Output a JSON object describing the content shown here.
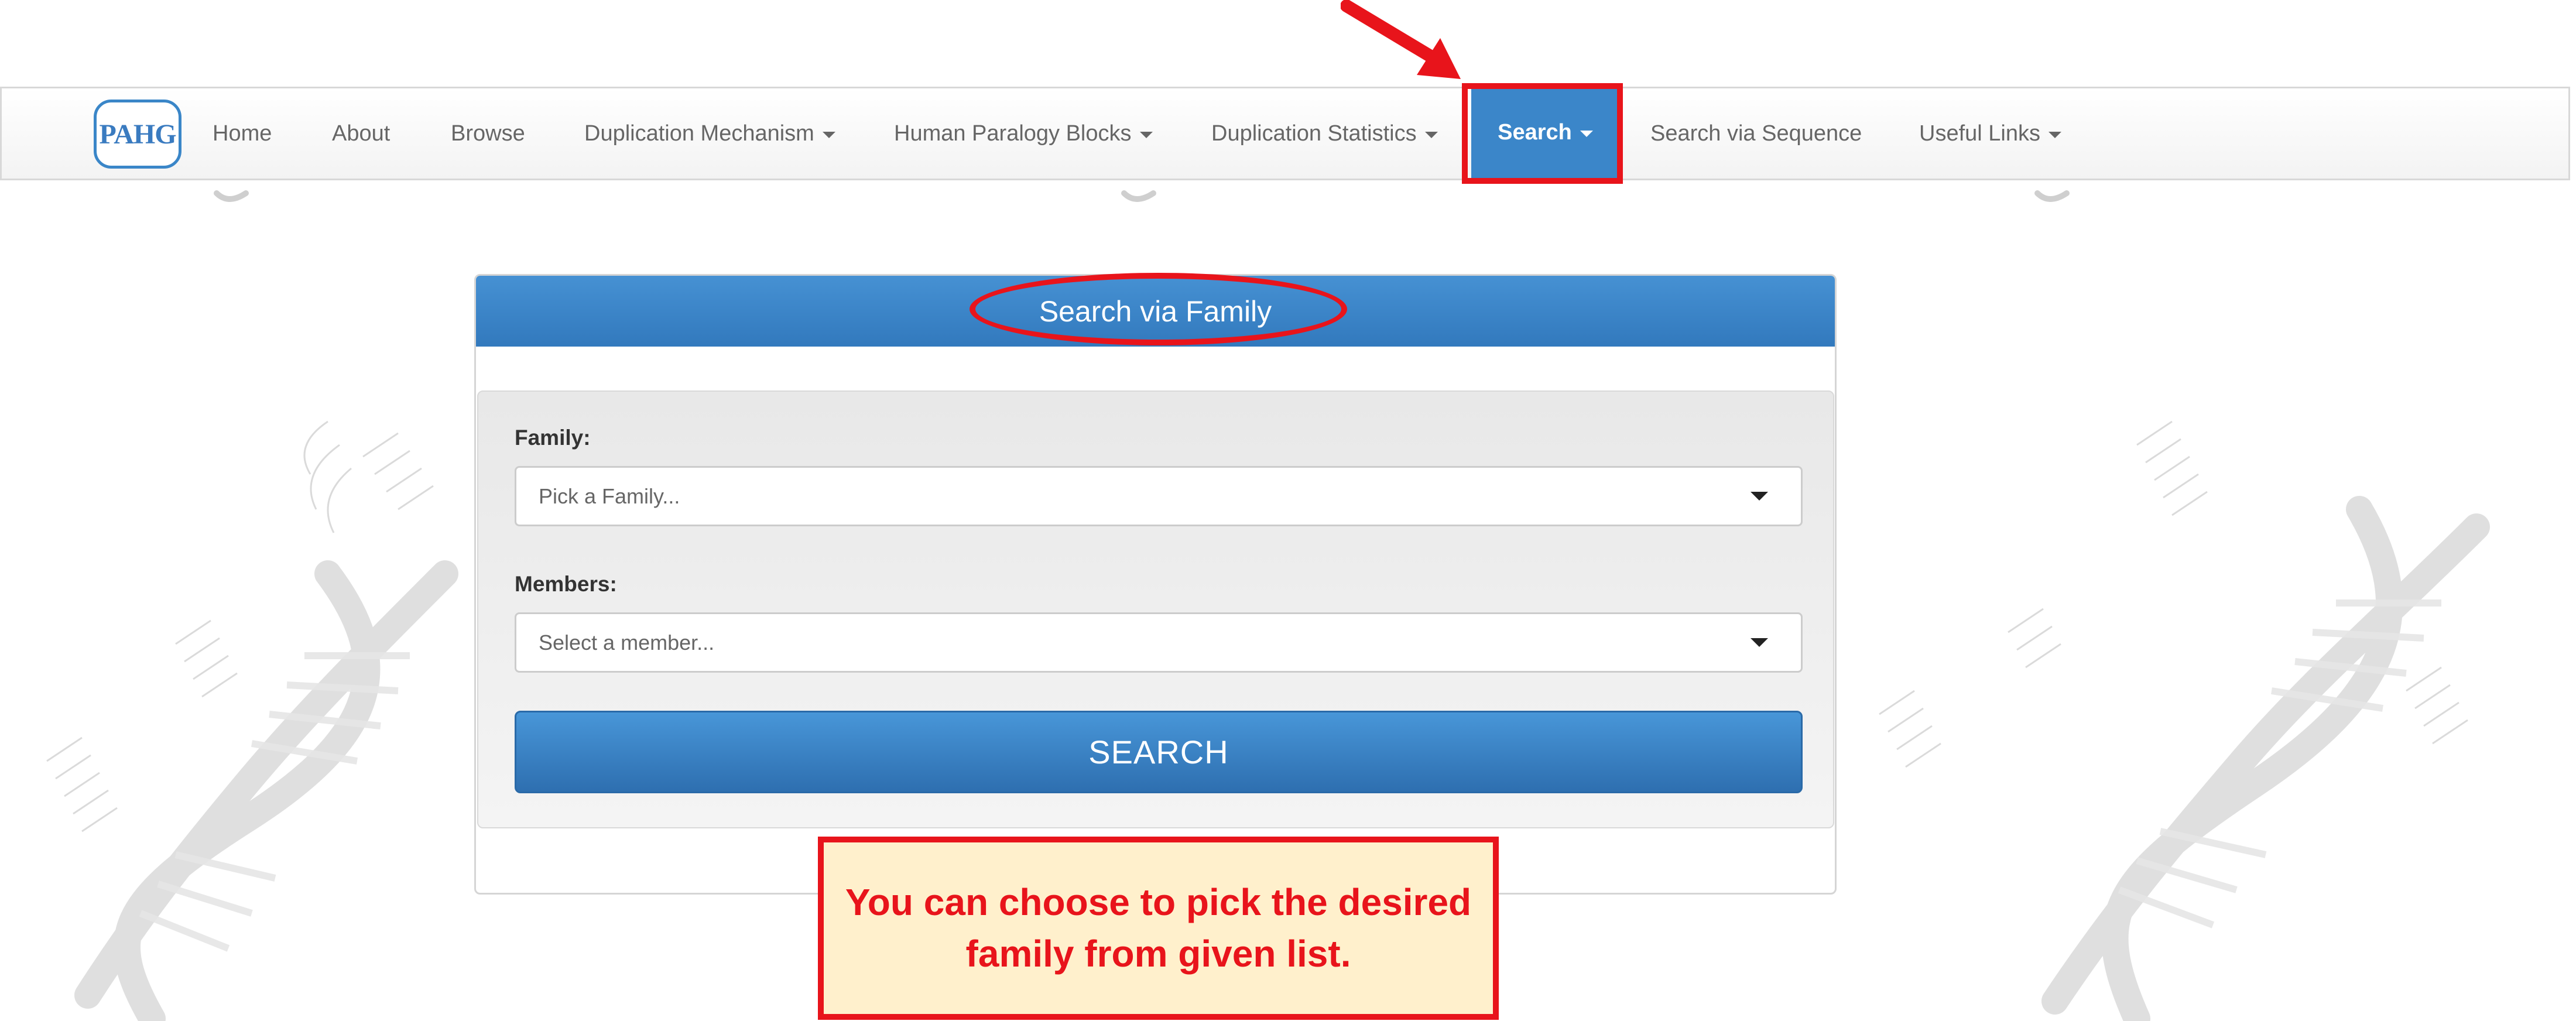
{
  "logo": {
    "text": "PAHG"
  },
  "nav": {
    "items": [
      {
        "label": "Home",
        "dropdown": false
      },
      {
        "label": "About",
        "dropdown": false
      },
      {
        "label": "Browse",
        "dropdown": false
      },
      {
        "label": "Duplication Mechanism",
        "dropdown": true
      },
      {
        "label": "Human Paralogy Blocks",
        "dropdown": true
      },
      {
        "label": "Duplication Statistics",
        "dropdown": true
      },
      {
        "label": "Search",
        "dropdown": true,
        "active": true
      },
      {
        "label": "Search via Sequence",
        "dropdown": false
      },
      {
        "label": "Useful Links",
        "dropdown": true
      }
    ]
  },
  "panel": {
    "title": "Search via Family",
    "family_label": "Family:",
    "family_placeholder": "Pick a Family...",
    "members_label": "Members:",
    "members_placeholder": "Select a member...",
    "search_button": "SEARCH"
  },
  "annotation": {
    "callout_line1": "You can choose to pick the desired",
    "callout_line2": "family from given list."
  },
  "colors": {
    "accent_blue": "#3b86c9",
    "annotation_red": "#e8141b",
    "callout_bg": "#fff0cc"
  }
}
